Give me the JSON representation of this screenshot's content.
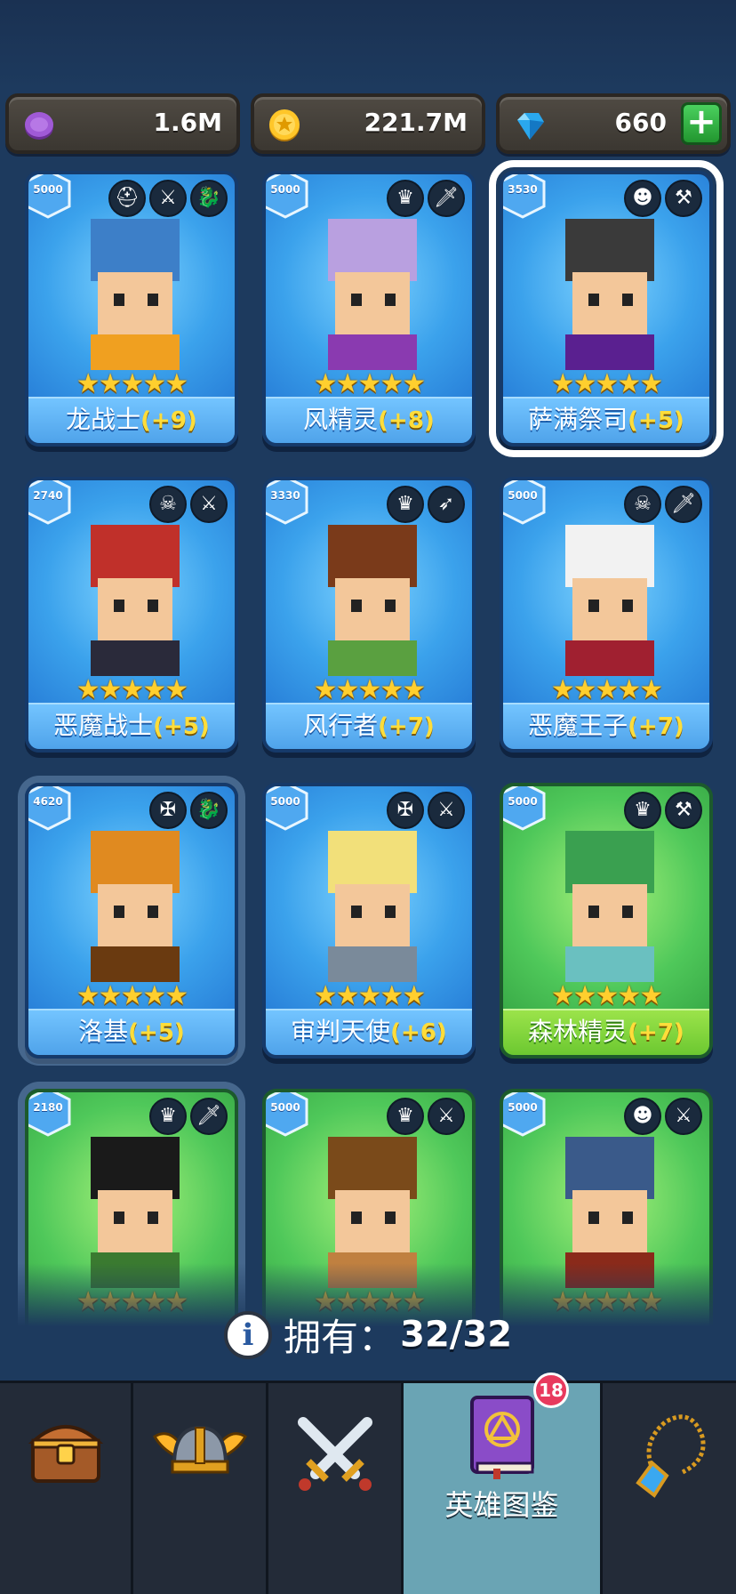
{
  "currencies": [
    {
      "name": "purple-coin",
      "value": "1.6M"
    },
    {
      "name": "gold-coin",
      "value": "221.7M"
    },
    {
      "name": "gem",
      "value": "660"
    }
  ],
  "cards": [
    {
      "name": "龙战士",
      "level": "(+9)",
      "power": "5000",
      "stars": "★★★★★",
      "theme": "blue",
      "icons": [
        "helmet-icon",
        "sword-icon",
        "dragon-icon"
      ]
    },
    {
      "name": "风精灵",
      "level": "(+8)",
      "power": "5000",
      "stars": "★★★★★",
      "theme": "blue",
      "icons": [
        "elf-icon",
        "dagger-icon"
      ]
    },
    {
      "name": "萨满祭司",
      "level": "(+5)",
      "power": "3530",
      "stars": "★★★★★",
      "theme": "blue",
      "icons": [
        "orc-icon",
        "hammer-icon"
      ],
      "selected": true
    },
    {
      "name": "恶魔战士",
      "level": "(+5)",
      "power": "2740",
      "stars": "★★★★★",
      "theme": "blue",
      "icons": [
        "demon-icon",
        "sword-icon"
      ]
    },
    {
      "name": "风行者",
      "level": "(+7)",
      "power": "3330",
      "stars": "★★★★★",
      "theme": "blue",
      "icons": [
        "elf-icon",
        "bow-icon"
      ]
    },
    {
      "name": "恶魔王子",
      "level": "(+7)",
      "power": "5000",
      "stars": "★★★★★",
      "theme": "blue",
      "icons": [
        "demon-icon",
        "dagger-icon"
      ]
    },
    {
      "name": "洛基",
      "level": "(+5)",
      "power": "4620",
      "stars": "★★★★★",
      "theme": "blue",
      "icons": [
        "angel-icon",
        "dragon-icon"
      ]
    },
    {
      "name": "审判天使",
      "level": "(+6)",
      "power": "5000",
      "stars": "★★★★★",
      "theme": "blue",
      "icons": [
        "angel-icon",
        "sword-icon"
      ]
    },
    {
      "name": "森林精灵",
      "level": "(+7)",
      "power": "5000",
      "stars": "★★★★★",
      "theme": "green",
      "icons": [
        "elf-icon",
        "hammer-icon"
      ]
    },
    {
      "name": "",
      "level": "",
      "power": "2180",
      "stars": "★★★★★",
      "theme": "green",
      "icons": [
        "elf-icon",
        "dagger-icon"
      ]
    },
    {
      "name": "",
      "level": "",
      "power": "5000",
      "stars": "★★★★★",
      "theme": "green",
      "icons": [
        "elf-icon",
        "sword-icon"
      ]
    },
    {
      "name": "",
      "level": "",
      "power": "5000",
      "stars": "★★★★★",
      "theme": "green",
      "icons": [
        "orc-icon",
        "sword-icon"
      ]
    }
  ],
  "owned": {
    "label": "拥有：",
    "count": "32/32"
  },
  "tabs": [
    {
      "name": "treasure-chest-icon",
      "label": ""
    },
    {
      "name": "viking-helmet-icon",
      "label": ""
    },
    {
      "name": "crossed-swords-icon",
      "label": ""
    },
    {
      "name": "spellbook-icon",
      "label": "英雄图鉴",
      "badge": "18",
      "active": true
    },
    {
      "name": "amulet-icon",
      "label": ""
    }
  ]
}
